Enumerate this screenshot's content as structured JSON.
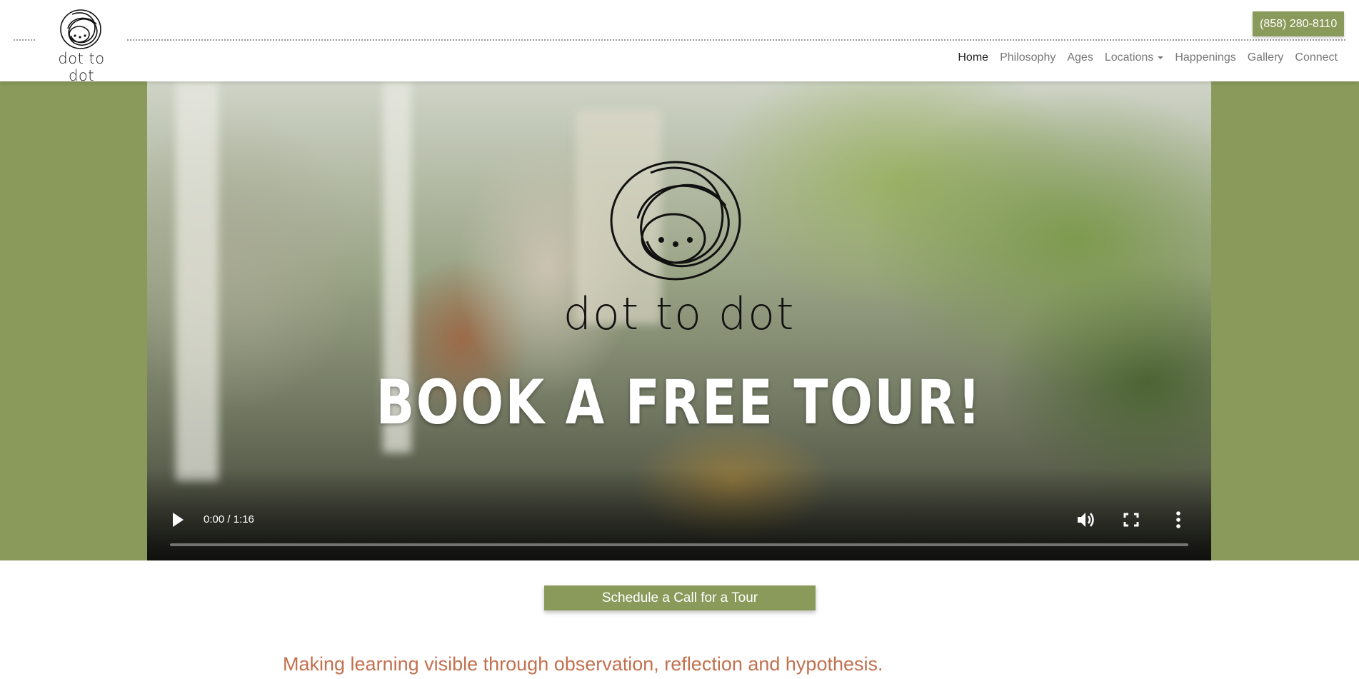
{
  "header": {
    "logo_text": "dot to dot",
    "phone": "(858) 280-8110",
    "nav": [
      {
        "label": "Home",
        "active": true
      },
      {
        "label": "Philosophy",
        "active": false
      },
      {
        "label": "Ages",
        "active": false
      },
      {
        "label": "Locations",
        "active": false,
        "dropdown": true
      },
      {
        "label": "Happenings",
        "active": false
      },
      {
        "label": "Gallery",
        "active": false
      },
      {
        "label": "Connect",
        "active": false
      }
    ]
  },
  "video": {
    "logo_text": "dot to dot",
    "headline": "BOOK A FREE TOUR!",
    "time": "0:00 / 1:16",
    "progress": 0,
    "icons": [
      "play-icon",
      "volume-icon",
      "fullscreen-icon",
      "more-options-icon"
    ]
  },
  "cta": {
    "label": "Schedule a Call for a Tour"
  },
  "tagline": "Making learning visible through observation, reflection and hypothesis.",
  "colors": {
    "accent": "#8a9a5b",
    "tagline": "#c2714f",
    "white": "#ffffff"
  }
}
